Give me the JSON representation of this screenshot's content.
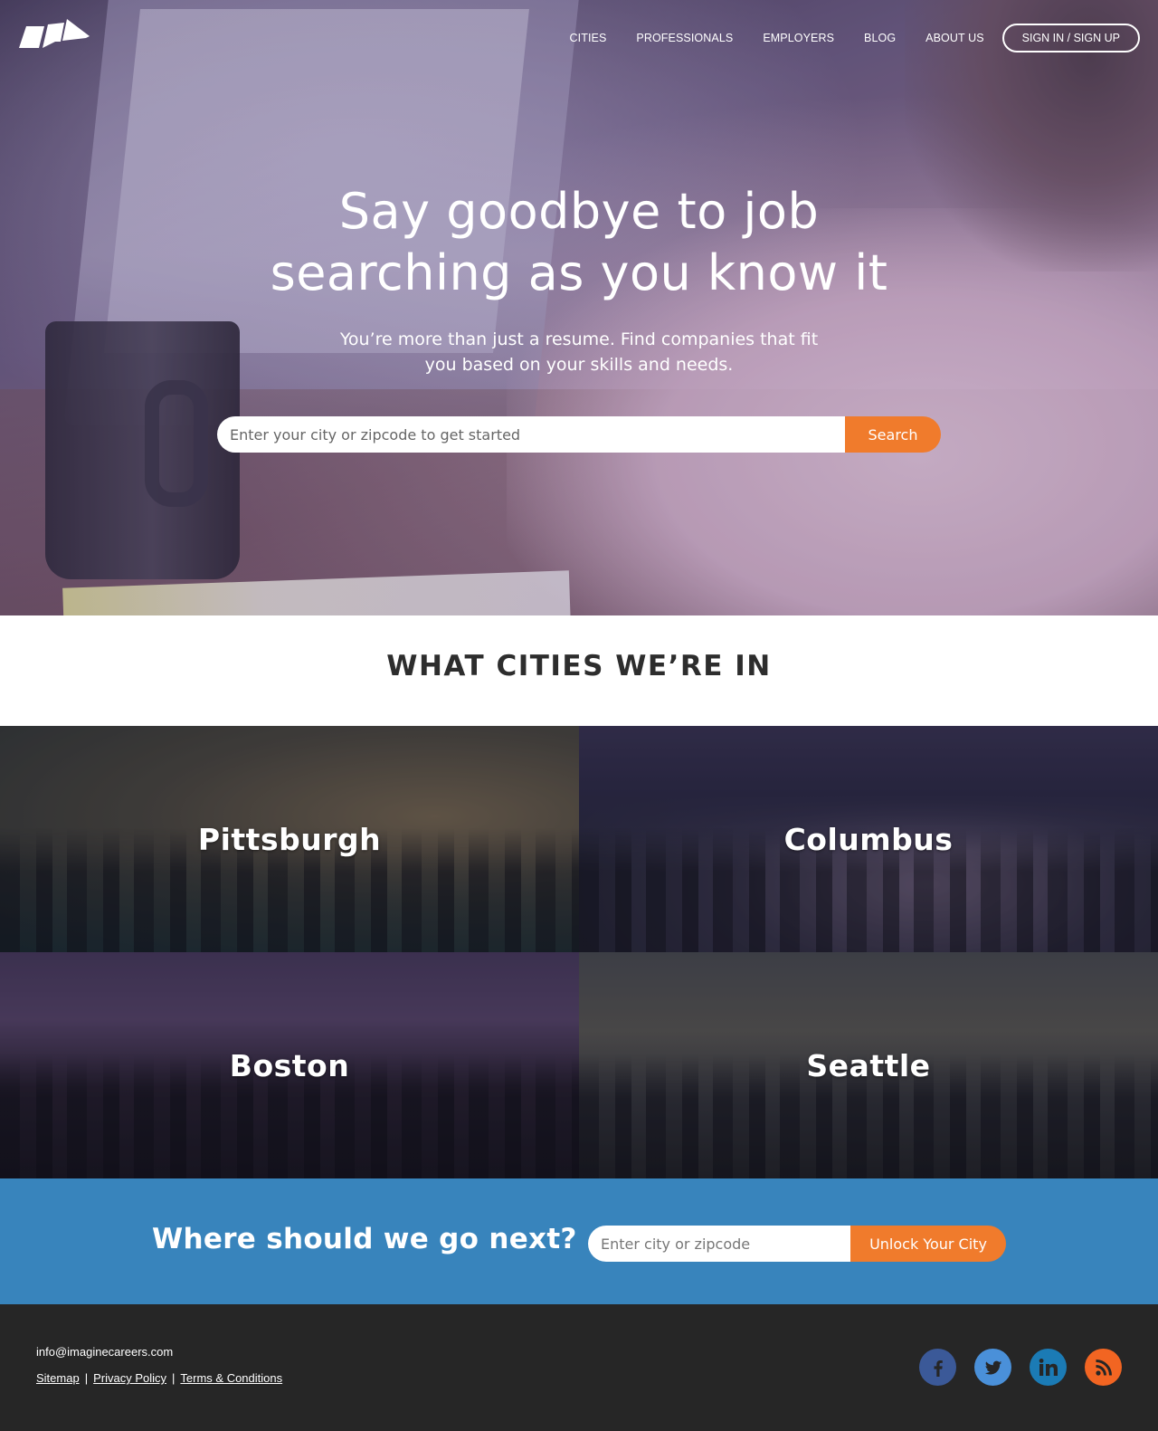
{
  "nav": {
    "links": [
      "CITIES",
      "PROFESSIONALS",
      "EMPLOYERS",
      "BLOG",
      "ABOUT US"
    ],
    "signin_label": "SIGN IN / SIGN UP"
  },
  "hero": {
    "title_line1": "Say goodbye to job",
    "title_line2": "searching as you know it",
    "subtitle_line1": "You’re more than just a resume. Find companies that fit",
    "subtitle_line2": "you based on your skills and needs.",
    "search_placeholder": "Enter your city or zipcode to get started",
    "search_button": "Search"
  },
  "cities": {
    "heading": "WHAT CITIES WE’RE IN",
    "items": [
      {
        "name": "Pittsburgh"
      },
      {
        "name": "Columbus"
      },
      {
        "name": "Boston"
      },
      {
        "name": "Seattle"
      }
    ]
  },
  "next_city": {
    "title": "Where should we go next?",
    "input_placeholder": "Enter city or zipcode",
    "button": "Unlock Your City"
  },
  "footer": {
    "email": "info@imaginecareers.com",
    "links": [
      "Sitemap",
      "Privacy Policy",
      "Terms & Conditions"
    ],
    "separator": "|",
    "socials": [
      {
        "icon": "facebook-icon",
        "color": "#3b5998"
      },
      {
        "icon": "twitter-icon",
        "color": "#4a90d9"
      },
      {
        "icon": "linkedin-icon",
        "color": "#1b7bb5"
      },
      {
        "icon": "rss-icon",
        "color": "#f26522"
      }
    ]
  },
  "colors": {
    "accent_orange": "#f07b2c",
    "banner_blue": "#3884bc",
    "footer_dark": "#262626"
  }
}
